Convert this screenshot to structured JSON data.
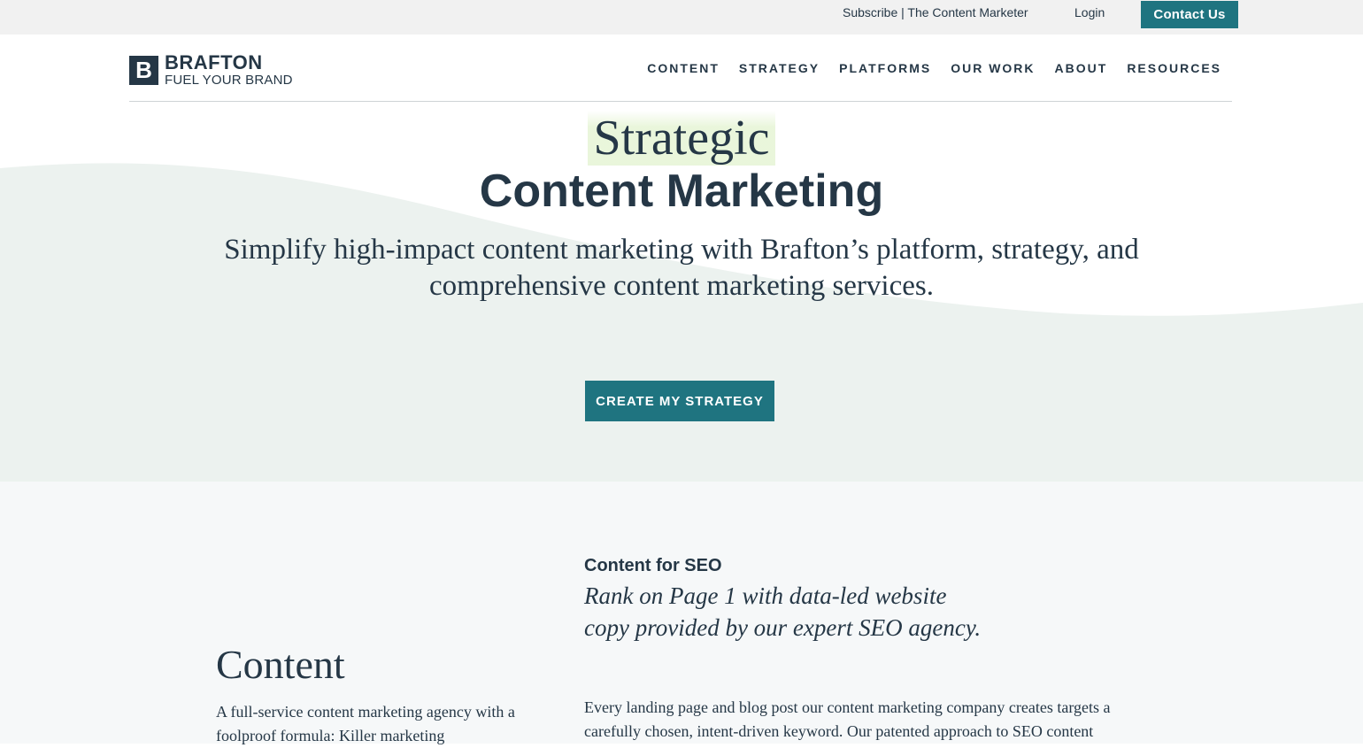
{
  "utility": {
    "subscribe": "Subscribe | The Content Marketer",
    "login": "Login",
    "contact": "Contact Us"
  },
  "logo": {
    "mark": "B",
    "name": "BRAFTON",
    "tagline": "FUEL YOUR BRAND"
  },
  "nav": {
    "items": [
      "CONTENT",
      "STRATEGY",
      "PLATFORMS",
      "OUR WORK",
      "ABOUT",
      "RESOURCES"
    ]
  },
  "hero": {
    "title_top": "Strategic",
    "title_bottom": "Content Marketing",
    "subtitle": "Simplify high-impact content marketing with Brafton’s platform, strategy, and comprehensive content marketing services.",
    "cta": "CREATE MY STRATEGY"
  },
  "section": {
    "heading": "Content",
    "description": "A full-service content marketing agency with a foolproof formula: Killer marketing",
    "seo_label": "Content for SEO",
    "seo_tagline": "Rank on Page 1 with data-led website copy provided by our expert SEO agency.",
    "seo_body": "Every landing page and blog post our content marketing company creates targets a carefully chosen, intent-driven keyword. Our patented approach to SEO content"
  },
  "colors": {
    "accent": "#1f7480",
    "text": "#253746",
    "hero_band": "#ecf2ef",
    "section_bg": "#f6f8f9"
  }
}
